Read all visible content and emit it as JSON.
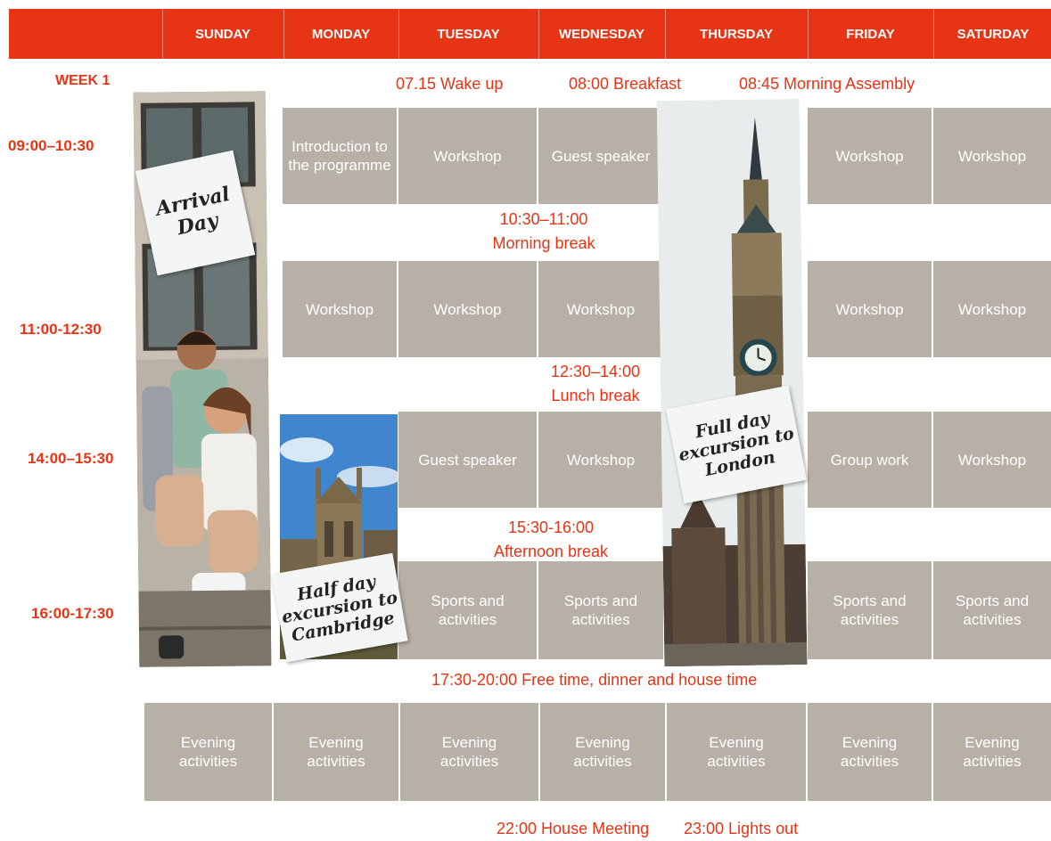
{
  "header": {
    "days": [
      "SUNDAY",
      "MONDAY",
      "TUESDAY",
      "WEDNESDAY",
      "THURSDAY",
      "FRIDAY",
      "SATURDAY"
    ]
  },
  "week_label": "WEEK 1",
  "morning_routine": {
    "wake": "07.15 Wake up",
    "breakfast": "08:00 Breakfast",
    "assembly": "08:45 Morning Assembly"
  },
  "times": {
    "slot1": "09:00–10:30",
    "slot2": "11:00-12:30",
    "slot3": "14:00–15:30",
    "slot4": "16:00-17:30"
  },
  "breaks": {
    "morning_time": "10:30–11:00",
    "morning_label": "Morning break",
    "lunch_time": "12:30–14:00",
    "lunch_label": "Lunch break",
    "afternoon_time": "15:30-16:00",
    "afternoon_label": "Afternoon break",
    "free_time": "17:30-20:00 Free time, dinner and house time"
  },
  "slot1": {
    "monday": "Introduction to the programme",
    "tuesday": "Workshop",
    "wednesday": "Guest speaker",
    "friday": "Workshop",
    "saturday": "Workshop"
  },
  "slot2": {
    "monday": "Workshop",
    "tuesday": "Workshop",
    "wednesday": "Workshop",
    "friday": "Workshop",
    "saturday": "Workshop"
  },
  "slot3": {
    "tuesday": "Guest speaker",
    "wednesday": "Workshop",
    "friday": "Group work",
    "saturday": "Workshop"
  },
  "slot4": {
    "tuesday": "Sports and activities",
    "wednesday": "Sports and activities",
    "friday": "Sports and activities",
    "saturday": "Sports and activities"
  },
  "evening": {
    "label": "Evening activities"
  },
  "notes": {
    "arrival": "Arrival Day",
    "cambridge": "Half day excursion to Cambridge",
    "london": "Full day excursion to London"
  },
  "night": {
    "meeting": "22:00 House Meeting",
    "lights": "23:00 Lights out"
  },
  "colors": {
    "accent": "#e63414",
    "cell": "#b7b0a7"
  }
}
